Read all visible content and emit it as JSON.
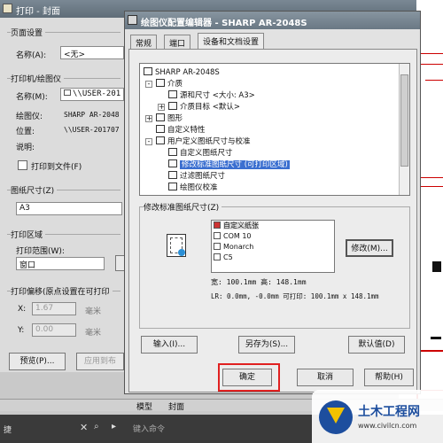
{
  "print_dialog": {
    "title": "打印 - 封面",
    "page_setup": {
      "group": "页面设置",
      "name_label": "名称(A):",
      "name_value": "<无>"
    },
    "printer": {
      "group": "打印机/绘图仪",
      "name_label": "名称(M):",
      "name_value": "\\\\USER-201",
      "plotter_label": "绘图仪:",
      "plotter_value": "SHARP AR-2048",
      "location_label": "位置:",
      "location_value": "\\\\USER-201707",
      "desc_label": "说明:",
      "print_to_file_label": "打印到文件(F)"
    },
    "paper": {
      "group": "图纸尺寸(Z)",
      "value": "A3"
    },
    "area": {
      "group": "打印区域",
      "range_label": "打印范围(W):",
      "range_value": "窗口"
    },
    "offset": {
      "group": "打印偏移(原点设置在可打印",
      "x_label": "X:",
      "x_value": "1.67",
      "x_unit": "毫米",
      "y_label": "Y:",
      "y_value": "0.00",
      "y_unit": "毫米"
    },
    "preview_button": "预览(P)...",
    "apply_button": "应用到布"
  },
  "cfg_dialog": {
    "title": "绘图仪配置编辑器 - SHARP AR-2048S",
    "tabs": [
      "常规",
      "端口",
      "设备和文档设置"
    ],
    "tree": [
      {
        "text": "SHARP AR-2048S",
        "indent": 0,
        "exp": ""
      },
      {
        "text": "介质",
        "indent": 1,
        "exp": "-"
      },
      {
        "text": "源和尺寸 <大小: A3>",
        "indent": 2,
        "exp": ""
      },
      {
        "text": "介质目标 <默认>",
        "indent": 2,
        "exp": "+"
      },
      {
        "text": "图形",
        "indent": 1,
        "exp": "+"
      },
      {
        "text": "自定义特性",
        "indent": 1,
        "exp": ""
      },
      {
        "text": "用户定义图纸尺寸与校准",
        "indent": 1,
        "exp": "-"
      },
      {
        "text": "自定义图纸尺寸",
        "indent": 2,
        "exp": ""
      },
      {
        "text": "修改标准图纸尺寸 (可打印区域)",
        "indent": 2,
        "exp": "",
        "selected": true
      },
      {
        "text": "过滤图纸尺寸",
        "indent": 2,
        "exp": ""
      },
      {
        "text": "绘图仪校准",
        "indent": 2,
        "exp": ""
      }
    ],
    "modify_group": "修改标准图纸尺寸(Z)",
    "sizes": [
      {
        "text": "自定义纸张",
        "selected": true
      },
      {
        "text": "COM 10"
      },
      {
        "text": "Monarch"
      },
      {
        "text": "C5"
      }
    ],
    "modify_button": "修改(M)...",
    "size_info": "宽: 100.1mm 高: 148.1mm",
    "margin_info": "LR: 0.0mm, -0.0mm  可打印: 100.1mm x 148.1mm",
    "import_button": "输入(I)...",
    "saveas_button": "另存为(S)...",
    "defaults_button": "默认值(D)",
    "ok_button": "确定",
    "cancel_button": "取消",
    "help_button": "帮助(H)"
  },
  "bottom": {
    "tab_model": "模型",
    "tab_cover": "封面",
    "command_placeholder": "键入命令",
    "left_stub": "捷"
  },
  "watermark": {
    "text": "土木工程网",
    "url": "www.civilcn.com"
  },
  "colors": {
    "accent": "#e02020",
    "titlebar": "#6a7884",
    "selection": "#3b6fd0"
  }
}
